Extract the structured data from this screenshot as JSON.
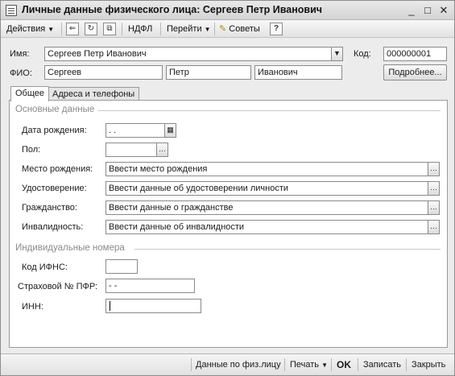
{
  "window": {
    "title": "Личные данные физического лица: Сергеев Петр Иванович",
    "controls": {
      "minimize": "_",
      "maximize": "□",
      "close": "✕"
    }
  },
  "toolbar": {
    "actions": "Действия",
    "ndfl": "НДФЛ",
    "goto": "Перейти",
    "tips": "Советы",
    "help": "?"
  },
  "form": {
    "name_label": "Имя:",
    "name_value": "Сергеев Петр Иванович",
    "code_label": "Код:",
    "code_value": "000000001",
    "fio_label": "ФИО:",
    "last_name": "Сергеев",
    "first_name": "Петр",
    "middle_name": "Иванович",
    "more_button": "Подробнее..."
  },
  "tabs": [
    {
      "label": "Общее",
      "active": true
    },
    {
      "label": "Адреса и телефоны",
      "active": false
    }
  ],
  "general": {
    "section_main": "Основные данные",
    "birth_date_label": "Дата рождения:",
    "birth_date_value": " .  .",
    "gender_label": "Пол:",
    "gender_value": "",
    "birthplace_label": "Место рождения:",
    "birthplace_value": "Ввести место рождения",
    "identity_label": "Удостоверение:",
    "identity_value": "Ввести данные об удостоверении личности",
    "citizenship_label": "Гражданство:",
    "citizenship_value": "Ввести данные о гражданстве",
    "disability_label": "Инвалидность:",
    "disability_value": "Ввести данные об инвалидности",
    "section_numbers": "Индивидуальные номера",
    "ifns_label": "Код ИФНС:",
    "ifns_value": "",
    "pfr_label": "Страховой № ПФР:",
    "pfr_value": "   -   -",
    "inn_label": "ИНН:",
    "inn_value": ""
  },
  "footer": {
    "person_data": "Данные по физ.лицу",
    "print": "Печать",
    "ok": "OK",
    "save": "Записать",
    "close": "Закрыть"
  }
}
